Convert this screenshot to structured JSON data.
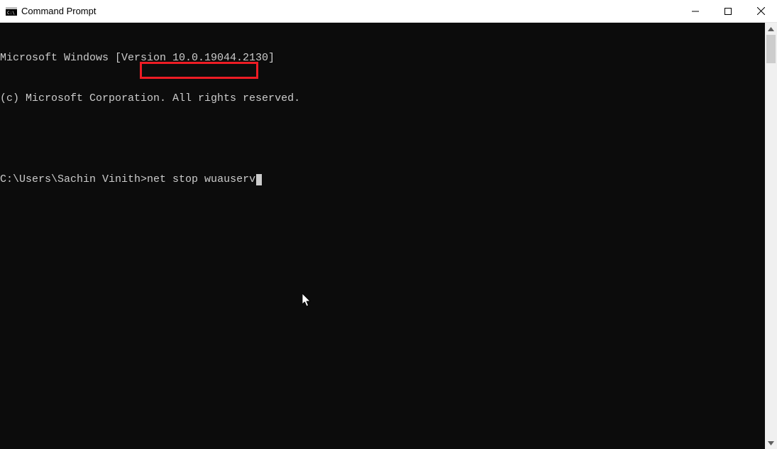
{
  "window": {
    "title": "Command Prompt"
  },
  "console": {
    "line1": "Microsoft Windows [Version 10.0.19044.2130]",
    "line2": "(c) Microsoft Corporation. All rights reserved.",
    "prompt": "C:\\Users\\Sachin Vinith>",
    "command": "net stop wuauserv"
  }
}
